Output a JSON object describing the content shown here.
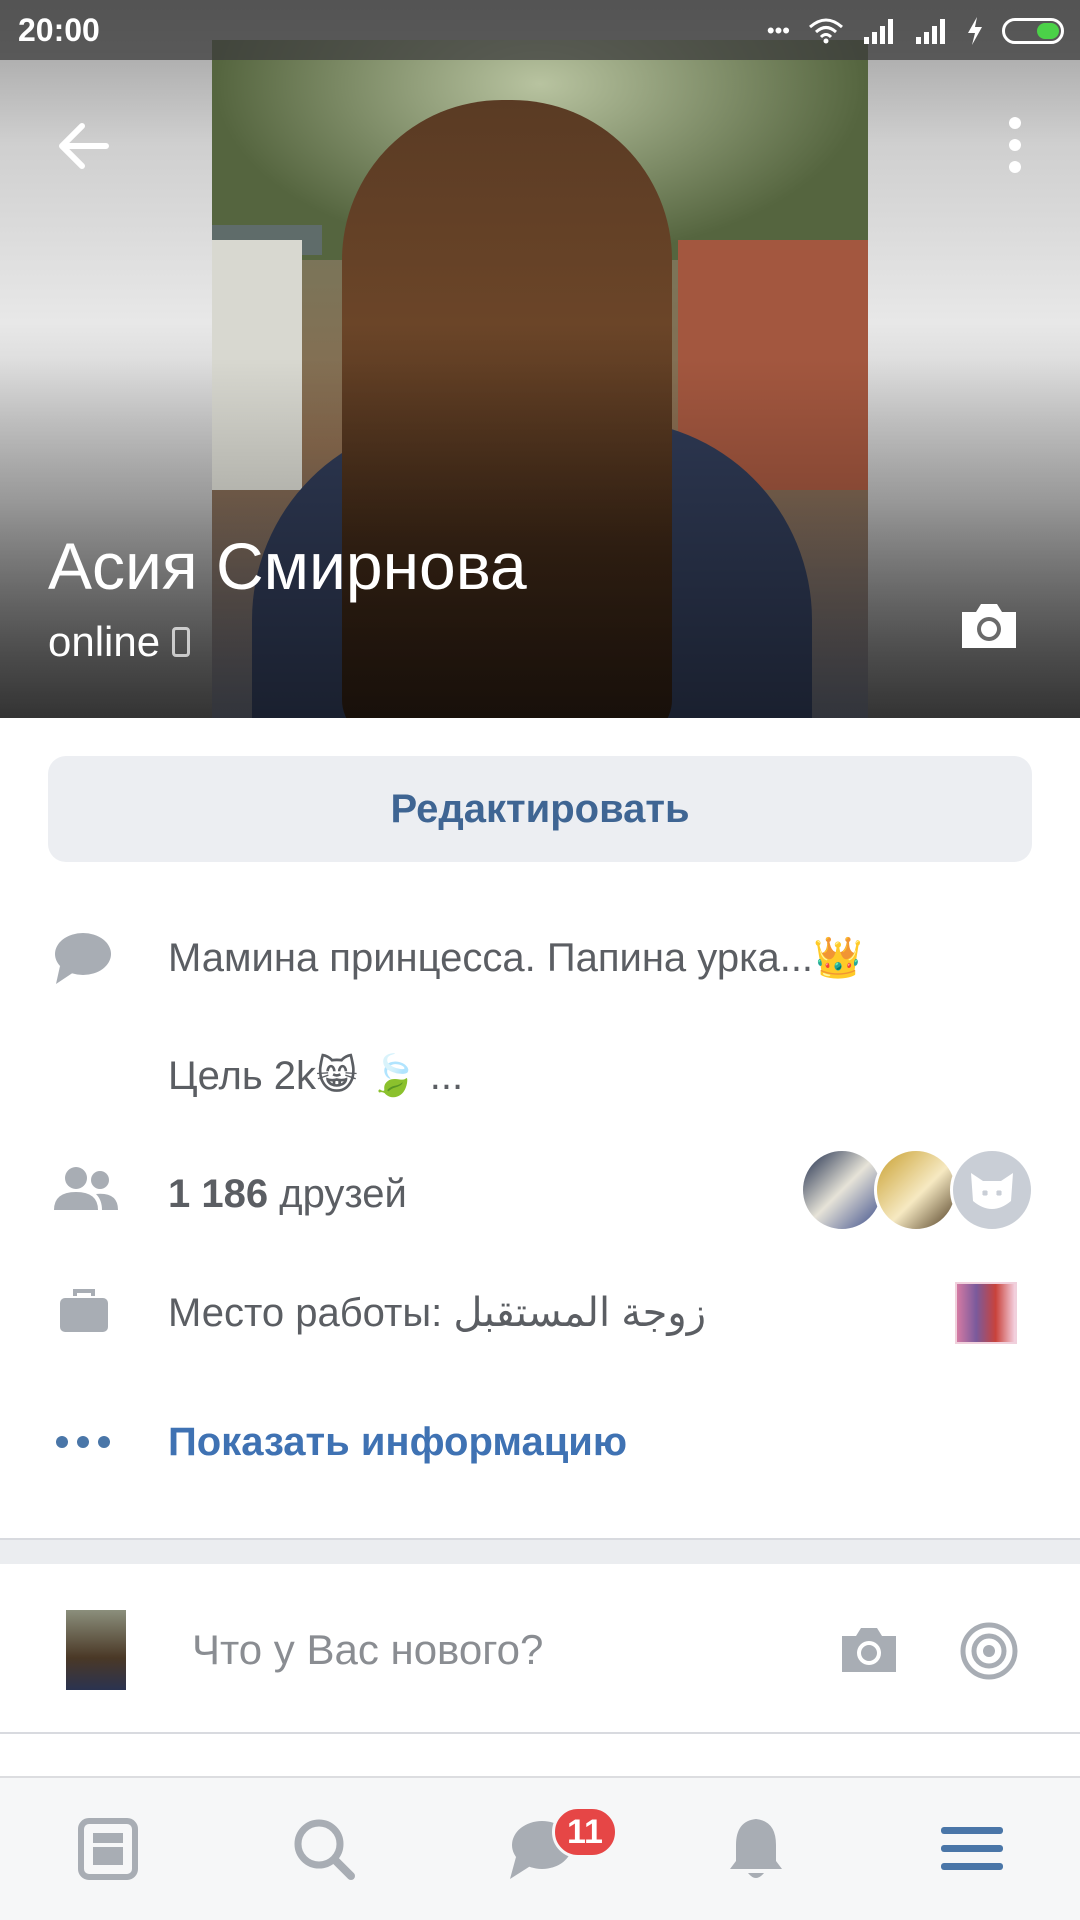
{
  "status_bar": {
    "time": "20:00",
    "dots": "•••",
    "battery_color": "#4bd148"
  },
  "profile": {
    "name": "Асия Смирнова",
    "status": "online",
    "edit_label": "Редактировать"
  },
  "info": {
    "bio_line1": "Мамина принцесса. Папина урка...👑",
    "bio_line2": "Цель 2k😸 🍃 ...",
    "friends_count": "1 186",
    "friends_label": " друзей",
    "work_label": "Место работы: ",
    "work_value": "زوجة المستقبل",
    "show_info": "Показать информацию"
  },
  "compose": {
    "placeholder": "Что у Вас нового?"
  },
  "tabbar": {
    "items": [
      "news-icon",
      "search-icon",
      "messages-icon",
      "notifications-icon",
      "menu-icon"
    ],
    "messages_badge": "11",
    "active_color": "#4a76a8"
  },
  "colors": {
    "link": "#3f72b3",
    "button_text": "#3f6593",
    "icon_gray": "#a8adb4"
  }
}
